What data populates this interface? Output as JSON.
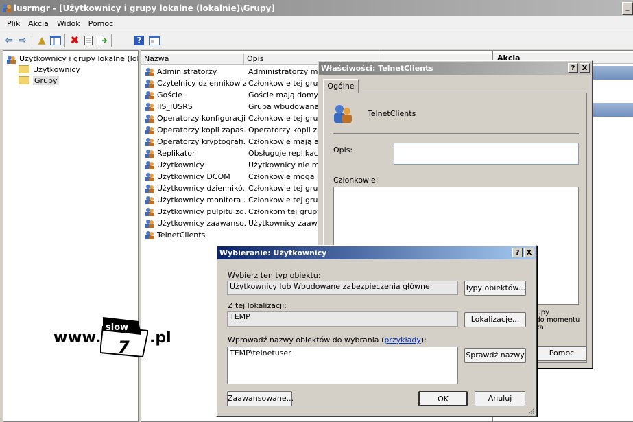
{
  "window": {
    "title": "lusrmgr - [Użytkownicy i grupy lokalne (lokalnie)\\Grupy]",
    "minimize_glyph": "_"
  },
  "menu": [
    "Plik",
    "Akcja",
    "Widok",
    "Pomoc"
  ],
  "toolbar_icons": [
    "back-arrow-icon",
    "forward-arrow-icon",
    "up-folder-icon",
    "show-tree-icon",
    "delete-icon",
    "properties-icon",
    "export-icon",
    "help-icon",
    "console-icon"
  ],
  "tree": {
    "root": "Użytkownicy i grupy lokalne (lokalni",
    "items": [
      "Użytkownicy",
      "Grupy"
    ]
  },
  "list": {
    "columns": [
      "Nazwa",
      "Opis"
    ],
    "rows": [
      {
        "name": "Administratorzy",
        "desc": "Administratorzy mają"
      },
      {
        "name": "Czytelnicy dzienników z...",
        "desc": "Członkowie tej grupy"
      },
      {
        "name": "Goście",
        "desc": "Goście mają domyślni"
      },
      {
        "name": "IIS_IUSRS",
        "desc": "Grupa wbudowana u"
      },
      {
        "name": "Operatorzy konfiguracji...",
        "desc": "Członkowie tej grupy"
      },
      {
        "name": "Operatorzy kopii zapas...",
        "desc": "Operatorzy kopii zapa"
      },
      {
        "name": "Operatorzy kryptografi...",
        "desc": "Członkowie mają auto"
      },
      {
        "name": "Replikator",
        "desc": "Obsługuje replikację"
      },
      {
        "name": "Użytkownicy",
        "desc": "Użytkownicy nie mog"
      },
      {
        "name": "Użytkownicy DCOM",
        "desc": "Członkowie mogą uru"
      },
      {
        "name": "Użytkownicy dziennikó...",
        "desc": "Członkowie tej grupy"
      },
      {
        "name": "Użytkownicy monitora ...",
        "desc": "Członkowie tej grupy"
      },
      {
        "name": "Użytkownicy pulpitu zd...",
        "desc": "Członkom tej grupy u"
      },
      {
        "name": "Użytkownicy zaawanso...",
        "desc": "Użytkownicy zaawan"
      },
      {
        "name": "TelnetClients",
        "desc": ""
      }
    ]
  },
  "actions": {
    "header": "Akcja"
  },
  "properties": {
    "title": "Właściwości: TelnetClients",
    "help_glyph": "?",
    "close_glyph": "X",
    "tab": "Ogólne",
    "group_name": "TelnetClients",
    "desc_label": "Opis:",
    "members_label": "Członkowie:",
    "note_lines": [
      "grupy",
      "e do momentu",
      "nika."
    ],
    "help_button": "Pomoc"
  },
  "select": {
    "title": "Wybieranie: Użytkownicy",
    "help_glyph": "?",
    "close_glyph": "X",
    "type_label": "Wybierz ten typ obiektu:",
    "type_value": "Użytkownicy lub Wbudowane zabezpieczenia główne",
    "type_button": "Typy obiektów...",
    "loc_label": "Z tej lokalizacji:",
    "loc_value": "TEMP",
    "loc_button": "Lokalizacje...",
    "names_label": "Wprowadź nazwy obiektów do wybrania (",
    "names_link": "przykłady",
    "names_label_end": "):",
    "names_value": "TEMP\\telnetuser",
    "check_button": "Sprawdź nazwy",
    "advanced_button": "Zaawansowane...",
    "ok_button": "OK",
    "cancel_button": "Anuluj"
  },
  "watermark": {
    "prefix": "www.",
    "badge_top": "slow",
    "badge_num": "7",
    "suffix": ".pl"
  },
  "colors": {
    "dialog_title": "#0a246a",
    "inactive_title": "#808080",
    "select_bg": "#d4d0c8"
  }
}
